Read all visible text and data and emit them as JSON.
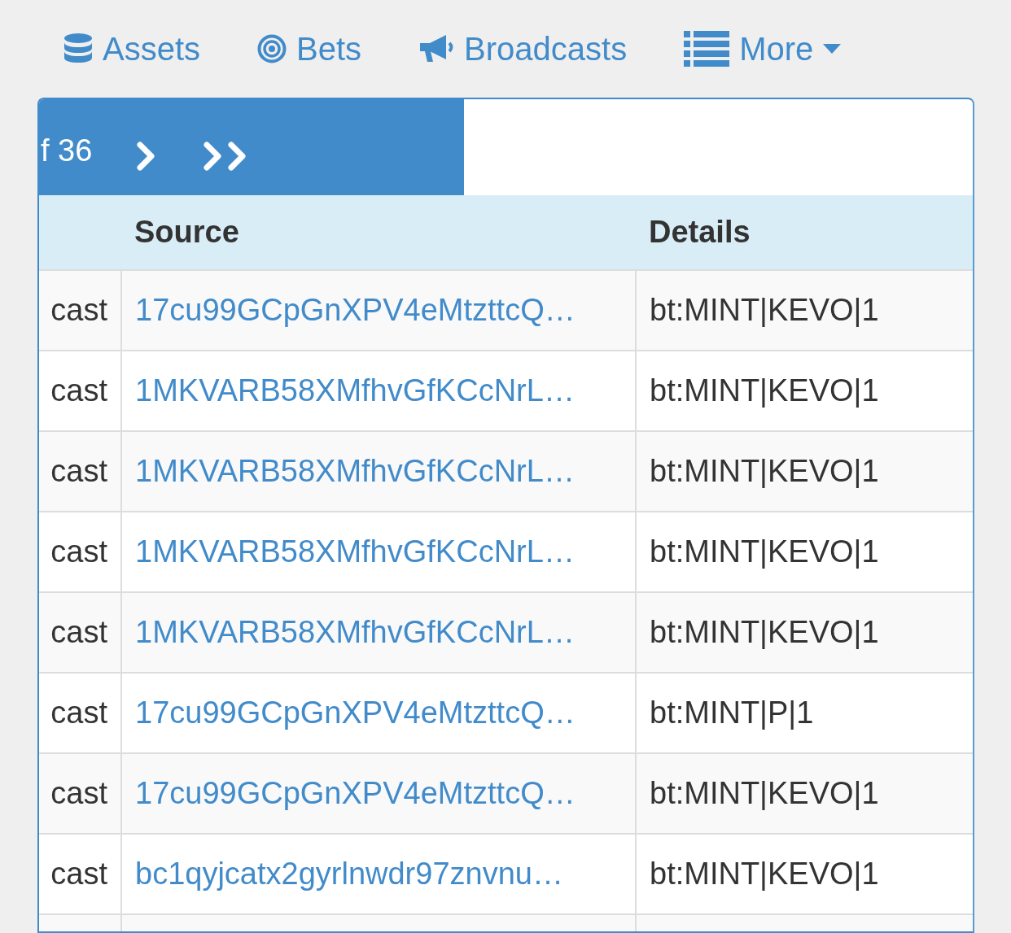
{
  "nav": [
    {
      "kind": "database",
      "label": "Assets"
    },
    {
      "kind": "bullseye",
      "label": "Bets"
    },
    {
      "kind": "bullhorn",
      "label": "Broadcasts"
    },
    {
      "kind": "list",
      "label": "More",
      "dropdown": true
    }
  ],
  "pagination": {
    "page_text": "f 36"
  },
  "table": {
    "columns": [
      {
        "label": "Source"
      },
      {
        "label": "Details"
      }
    ],
    "rows": [
      {
        "column_1": "cast",
        "source": "17cu99GCpGnXPV4eMtzttcQ…",
        "details": "bt:MINT|KEVO|1"
      },
      {
        "column_1": "cast",
        "source": "1MKVARB58XMfhvGfKCcNrL…",
        "details": "bt:MINT|KEVO|1"
      },
      {
        "column_1": "cast",
        "source": "1MKVARB58XMfhvGfKCcNrL…",
        "details": "bt:MINT|KEVO|1"
      },
      {
        "column_1": "cast",
        "source": "1MKVARB58XMfhvGfKCcNrL…",
        "details": "bt:MINT|KEVO|1"
      },
      {
        "column_1": "cast",
        "source": "1MKVARB58XMfhvGfKCcNrL…",
        "details": "bt:MINT|KEVO|1"
      },
      {
        "column_1": "cast",
        "source": "17cu99GCpGnXPV4eMtzttcQ…",
        "details": "bt:MINT|P|1"
      },
      {
        "column_1": "cast",
        "source": "17cu99GCpGnXPV4eMtzttcQ…",
        "details": "bt:MINT|KEVO|1"
      },
      {
        "column_1": "cast",
        "source": "bc1qyjcatx2gyrlnwdr97znvnu…",
        "details": "bt:MINT|KEVO|1"
      }
    ]
  }
}
